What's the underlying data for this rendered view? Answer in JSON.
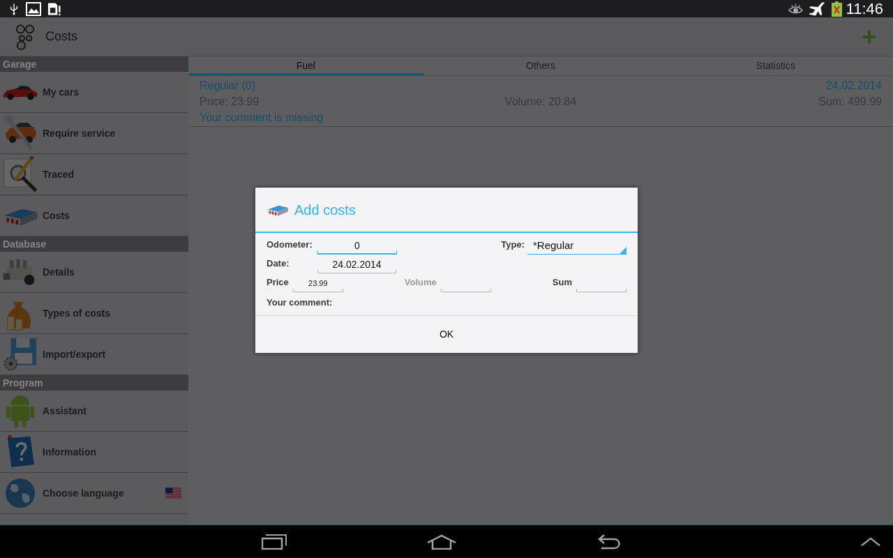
{
  "status_bar": {
    "time": "11:46"
  },
  "action_bar": {
    "title": "Costs"
  },
  "sidebar": [
    {
      "title": "Garage",
      "items": [
        {
          "label": "My cars",
          "kind": "nav"
        },
        {
          "label": "Require service",
          "kind": "nav"
        },
        {
          "label": "Traced",
          "kind": "nav"
        },
        {
          "label": "Costs",
          "kind": "nav"
        }
      ]
    },
    {
      "title": "Database",
      "items": [
        {
          "label": "Details",
          "kind": "nav"
        },
        {
          "label": "Types of costs",
          "kind": "nav"
        },
        {
          "label": "Import/export",
          "kind": "nav"
        }
      ]
    },
    {
      "title": "Program",
      "items": [
        {
          "label": "Assistant",
          "kind": "nav"
        },
        {
          "label": "Information",
          "kind": "nav"
        },
        {
          "label": "Choose language",
          "kind": "language"
        }
      ]
    }
  ],
  "tabs": [
    {
      "label": "Fuel",
      "selected": true
    },
    {
      "label": "Others",
      "selected": false
    },
    {
      "label": "Statistics",
      "selected": false
    }
  ],
  "entries": [
    {
      "title": "Regular (0)",
      "date": "24.02.2014",
      "price": "Price: 23.99",
      "volume": "Volume: 20.84",
      "sum": "Sum: 499.99",
      "comment": "Your comment is missing"
    }
  ],
  "dialog": {
    "title": "Add costs",
    "odometer": {
      "label": "Odometer:",
      "value": "0",
      "focused": true
    },
    "type": {
      "label": "Type:",
      "value": "*Regular"
    },
    "date": {
      "label": "Date:",
      "value": "24.02.2014",
      "focused": false
    },
    "price": {
      "label": "Price",
      "value": "23.99",
      "disabled": false
    },
    "volume": {
      "label": "Volume",
      "disabled": true
    },
    "sum": {
      "label": "Sum",
      "disabled": false
    },
    "comment": {
      "label": "Your comment:"
    },
    "buttons": [
      "OK"
    ]
  }
}
